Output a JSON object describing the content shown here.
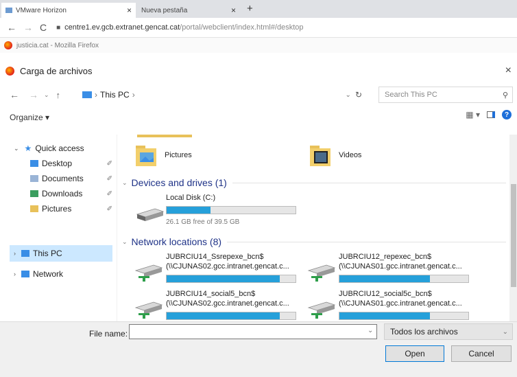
{
  "browser": {
    "tabs": [
      {
        "label": "VMware Horizon"
      },
      {
        "label": "Nueva pestaña"
      }
    ],
    "new_tab": "+",
    "url_host": "centre1.ev.gcb.extranet.gencat.cat",
    "url_path": "/portal/webclient/index.html#/desktop",
    "firefox_window_title": "justicia.cat - Mozilla Firefox"
  },
  "dialog": {
    "title": "Carga de archivos",
    "breadcrumb": [
      "This PC"
    ],
    "search_placeholder": "Search This PC",
    "organize_label": "Organize ▾"
  },
  "nav_pane": {
    "items": [
      {
        "label": "Quick access",
        "level": 0,
        "expanded": true
      },
      {
        "label": "Desktop",
        "level": 1,
        "pinned": true
      },
      {
        "label": "Documents",
        "level": 1,
        "pinned": true
      },
      {
        "label": "Downloads",
        "level": 1,
        "pinned": true
      },
      {
        "label": "Pictures",
        "level": 1,
        "pinned": true
      },
      {
        "label": "This PC",
        "level": 0,
        "selected": true
      },
      {
        "label": "Network",
        "level": 0
      }
    ]
  },
  "content": {
    "folders": [
      {
        "name": "Pictures"
      },
      {
        "name": "Videos"
      }
    ],
    "devices_header": "Devices and drives (1)",
    "drives": [
      {
        "name": "Local Disk (C:)",
        "free_text": "26.1 GB free of 39.5 GB",
        "used_fraction": 0.34
      }
    ],
    "network_header": "Network locations (8)",
    "network_locations": [
      {
        "name": "JUBRCIU14_Ssrepexe_bcn$",
        "path": "(\\\\CJUNAS02.gcc.intranet.gencat.c...",
        "used_fraction": 0.88
      },
      {
        "name": "JUBRCIU12_repexec_bcn$",
        "path": "(\\\\CJUNAS01.gcc.intranet.gencat.c...",
        "used_fraction": 0.7
      },
      {
        "name": "JUBRCIU14_social5_bcn$",
        "path": "(\\\\CJUNAS02.gcc.intranet.gencat.c...",
        "used_fraction": 0.88
      },
      {
        "name": "JUBRCIU12_social5c_bcn$",
        "path": "(\\\\CJUNAS01.gcc.intranet.gencat.c...",
        "used_fraction": 0.7
      }
    ]
  },
  "footer": {
    "file_name_label": "File name:",
    "file_name_value": "",
    "file_type": "Todos los archivos",
    "open_label": "Open",
    "cancel_label": "Cancel"
  },
  "colors": {
    "selection": "#cce8ff",
    "bar_fill": "#26a0da",
    "group_header": "#1e3287"
  }
}
